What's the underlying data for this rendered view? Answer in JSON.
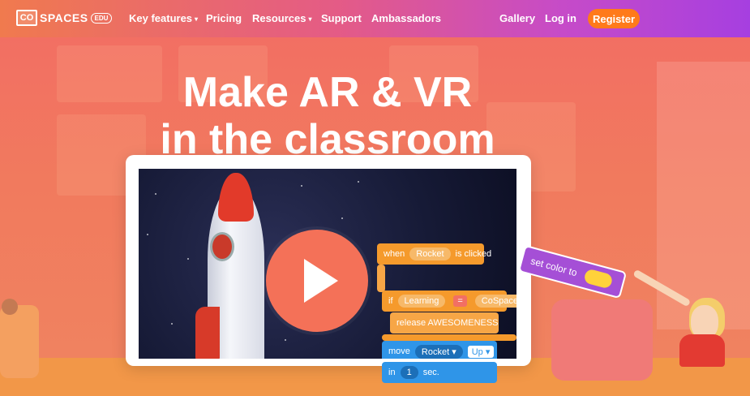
{
  "nav": {
    "logo_main": "CO",
    "logo_text": "SPACES",
    "logo_badge": "EDU",
    "items": [
      {
        "label": "Key features",
        "caret": "▾"
      },
      {
        "label": "Pricing"
      },
      {
        "label": "Resources",
        "caret": "▾"
      },
      {
        "label": "Support"
      },
      {
        "label": "Ambassadors"
      },
      {
        "label": "Gallery"
      },
      {
        "label": "Log in"
      }
    ],
    "register_label": "Register"
  },
  "hero": {
    "title_line1": "Make AR & VR",
    "title_line2": "in the classroom"
  },
  "code": {
    "when": "when",
    "rocket": "Rocket",
    "is_clicked": "is clicked",
    "if": "if",
    "learning": "Learning",
    "equals": "=",
    "cospaces": "CoSpaces",
    "release": "release AWESOMENESS",
    "move": "move",
    "rocket_dd": "Rocket ▾",
    "up_dd": "Up ▾",
    "in": "in",
    "one": "1",
    "sec": "sec.",
    "set_color": "set color to"
  },
  "colors": {
    "nav_start": "#f07a4e",
    "nav_end": "#a63fe0",
    "register": "#ff7a1a",
    "play_button": "#f47158",
    "block_orange": "#f59a2c",
    "block_blue": "#2f95e8",
    "block_purple": "#a54fd6"
  },
  "icons": {
    "play": "play-icon",
    "caret": "chevron-down-icon"
  }
}
